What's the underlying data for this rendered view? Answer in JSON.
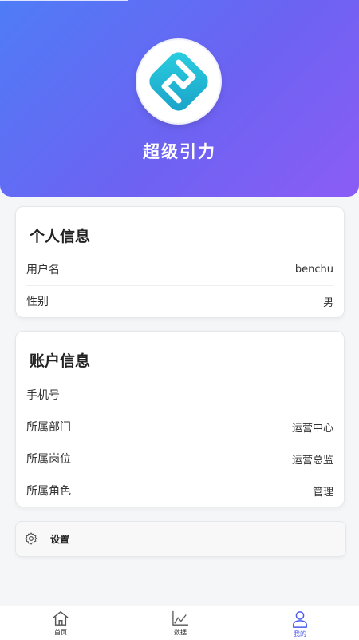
{
  "header": {
    "app_name": "超级引力"
  },
  "personal_info": {
    "title": "个人信息",
    "rows": [
      {
        "label": "用户名",
        "value": "benchu"
      },
      {
        "label": "性别",
        "value": "男"
      }
    ]
  },
  "account_info": {
    "title": "账户信息",
    "rows": [
      {
        "label": "手机号",
        "value": ""
      },
      {
        "label": "所属部门",
        "value": "运营中心"
      },
      {
        "label": "所属岗位",
        "value": "运营总监"
      },
      {
        "label": "所属角色",
        "value": "管理"
      }
    ]
  },
  "settings": {
    "label": "设置",
    "icon": "gear-icon"
  },
  "tabbar": {
    "active_color": "#4a5af0",
    "items": [
      {
        "label": "首页",
        "icon": "home-icon"
      },
      {
        "label": "数据",
        "icon": "chart-icon"
      },
      {
        "label": "我的",
        "icon": "person-icon",
        "active": true
      }
    ]
  }
}
